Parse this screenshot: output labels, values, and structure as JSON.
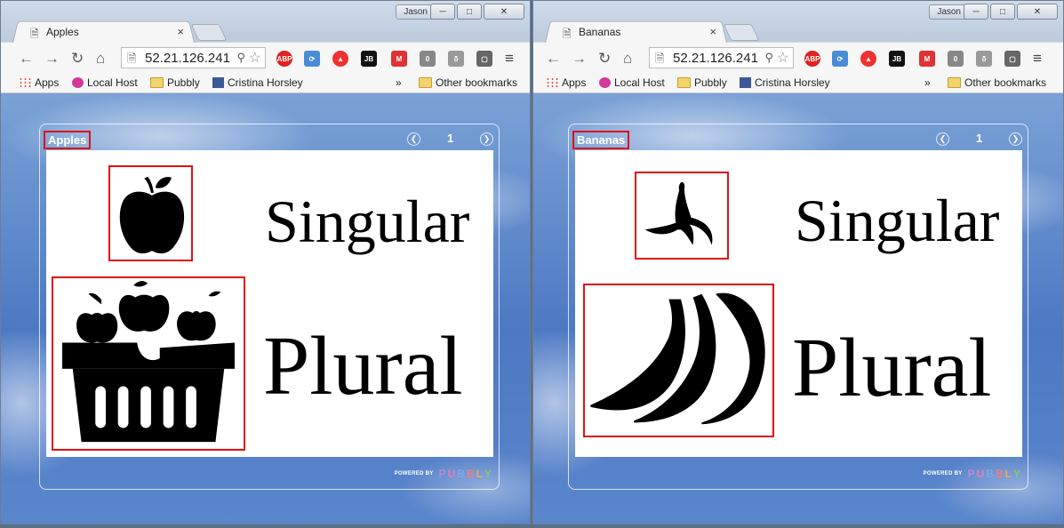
{
  "windows": [
    {
      "user": "Jason",
      "tab_title": "Apples",
      "url": "52.21.126.241",
      "bookmarks": [
        "Apps",
        "Local Host",
        "Pubbly",
        "Cristina Horsley"
      ],
      "more_bookmarks": "»",
      "other_bookmarks": "Other bookmarks",
      "book_title": "Apples",
      "page_number": "1",
      "singular_word": "Singular",
      "plural_word": "Plural",
      "singular_icon": "apple-icon",
      "plural_icon": "apple-basket-icon",
      "powered_by": "POWERED BY",
      "brand": [
        "P",
        "U",
        "B",
        "B",
        "L",
        "Y"
      ]
    },
    {
      "user": "Jason",
      "tab_title": "Bananas",
      "url": "52.21.126.241",
      "bookmarks": [
        "Apps",
        "Local Host",
        "Pubbly",
        "Cristina Horsley"
      ],
      "more_bookmarks": "»",
      "other_bookmarks": "Other bookmarks",
      "book_title": "Bananas",
      "page_number": "1",
      "singular_word": "Singular",
      "plural_word": "Plural",
      "singular_icon": "banana-peel-icon",
      "plural_icon": "banana-bunch-icon",
      "powered_by": "POWERED BY",
      "brand": [
        "P",
        "U",
        "B",
        "B",
        "L",
        "Y"
      ]
    }
  ],
  "colors": {
    "highlight_border": "#dd1111",
    "page_background": "#ffffff",
    "sky_blue": "#4d79c4"
  }
}
